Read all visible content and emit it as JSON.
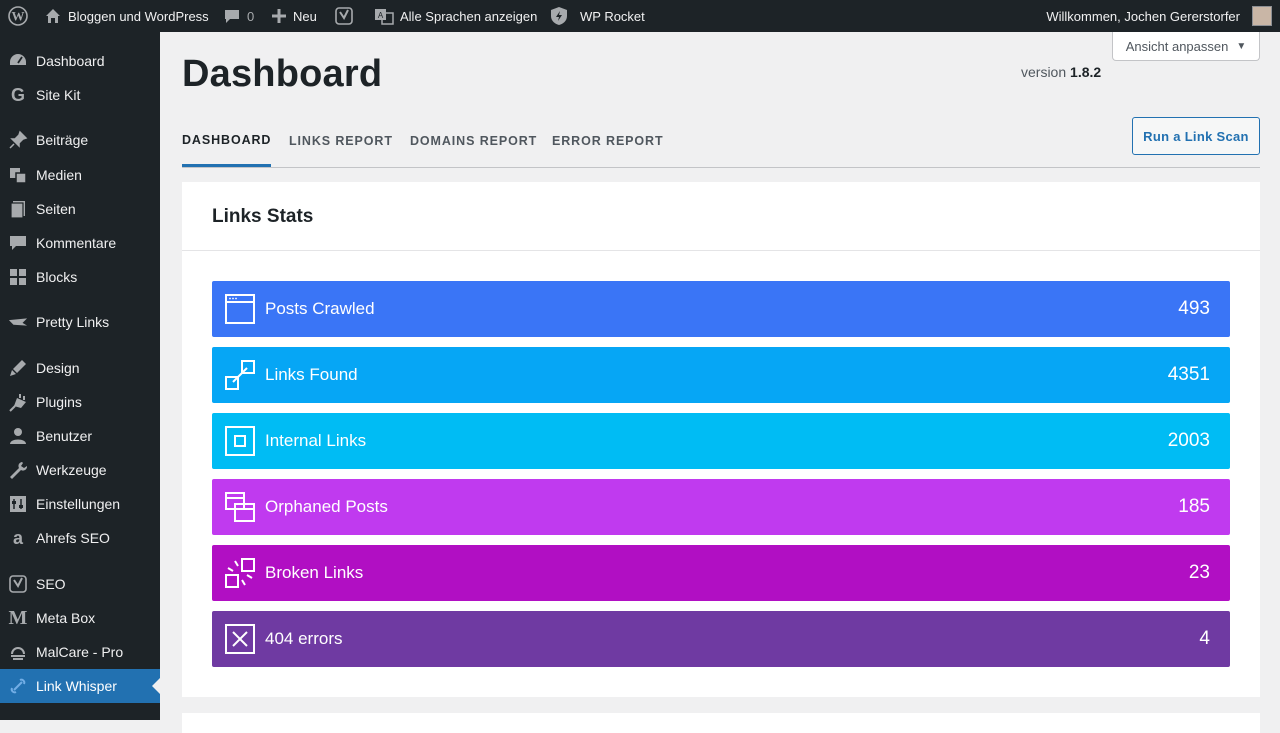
{
  "adminbar": {
    "site_name": "Bloggen und WordPress",
    "comments_count": "0",
    "new_label": "Neu",
    "languages_label": "Alle Sprachen anzeigen",
    "rocket_label": "WP Rocket",
    "greeting": "Willkommen, Jochen Gererstorfer"
  },
  "sidebar": {
    "items": [
      {
        "label": "Dashboard",
        "icon": "dashboard-icon"
      },
      {
        "label": "Site Kit",
        "icon": "google-g-icon"
      },
      {
        "label": "Beiträge",
        "icon": "pin-icon"
      },
      {
        "label": "Medien",
        "icon": "media-icon"
      },
      {
        "label": "Seiten",
        "icon": "pages-icon"
      },
      {
        "label": "Kommentare",
        "icon": "comment-icon"
      },
      {
        "label": "Blocks",
        "icon": "blocks-icon"
      },
      {
        "label": "Pretty Links",
        "icon": "pretty-links-icon"
      },
      {
        "label": "Design",
        "icon": "brush-icon"
      },
      {
        "label": "Plugins",
        "icon": "plug-icon"
      },
      {
        "label": "Benutzer",
        "icon": "user-icon"
      },
      {
        "label": "Werkzeuge",
        "icon": "wrench-icon"
      },
      {
        "label": "Einstellungen",
        "icon": "settings-icon"
      },
      {
        "label": "Ahrefs SEO",
        "icon": "ahrefs-icon"
      },
      {
        "label": "SEO",
        "icon": "yoast-icon"
      },
      {
        "label": "Meta Box",
        "icon": "metabox-icon"
      },
      {
        "label": "MalCare - Pro",
        "icon": "malcare-icon"
      },
      {
        "label": "Link Whisper",
        "icon": "link-whisper-icon",
        "active": true
      }
    ]
  },
  "screen_options": {
    "label": "Ansicht anpassen"
  },
  "page": {
    "title": "Dashboard",
    "version_prefix": "version",
    "version_number": "1.8.2"
  },
  "tabs": [
    {
      "label": "DASHBOARD",
      "active": true
    },
    {
      "label": "LINKS REPORT",
      "active": false
    },
    {
      "label": "DOMAINS REPORT",
      "active": false
    },
    {
      "label": "ERROR REPORT",
      "active": false
    }
  ],
  "scan_button": {
    "label": "Run a Link Scan"
  },
  "links_stats": {
    "title": "Links Stats",
    "stats": [
      {
        "label": "Posts Crawled",
        "value": "493",
        "color": "#3a75f6",
        "icon": "browser-window-icon"
      },
      {
        "label": "Links Found",
        "value": "4351",
        "color": "#06a6f5",
        "icon": "link-icon"
      },
      {
        "label": "Internal Links",
        "value": "2003",
        "color": "#00bcf4",
        "icon": "square-target-icon"
      },
      {
        "label": "Orphaned Posts",
        "value": "185",
        "color": "#c03aef",
        "icon": "stacked-windows-icon"
      },
      {
        "label": "Broken Links",
        "value": "23",
        "color": "#b10fc3",
        "icon": "broken-link-icon"
      },
      {
        "label": "404 errors",
        "value": "4",
        "color": "#6f3aa2",
        "icon": "x-box-icon"
      }
    ]
  },
  "colors": {
    "admin_bg": "#1d2327",
    "accent": "#2271b1",
    "page_bg": "#f0f0f1"
  }
}
